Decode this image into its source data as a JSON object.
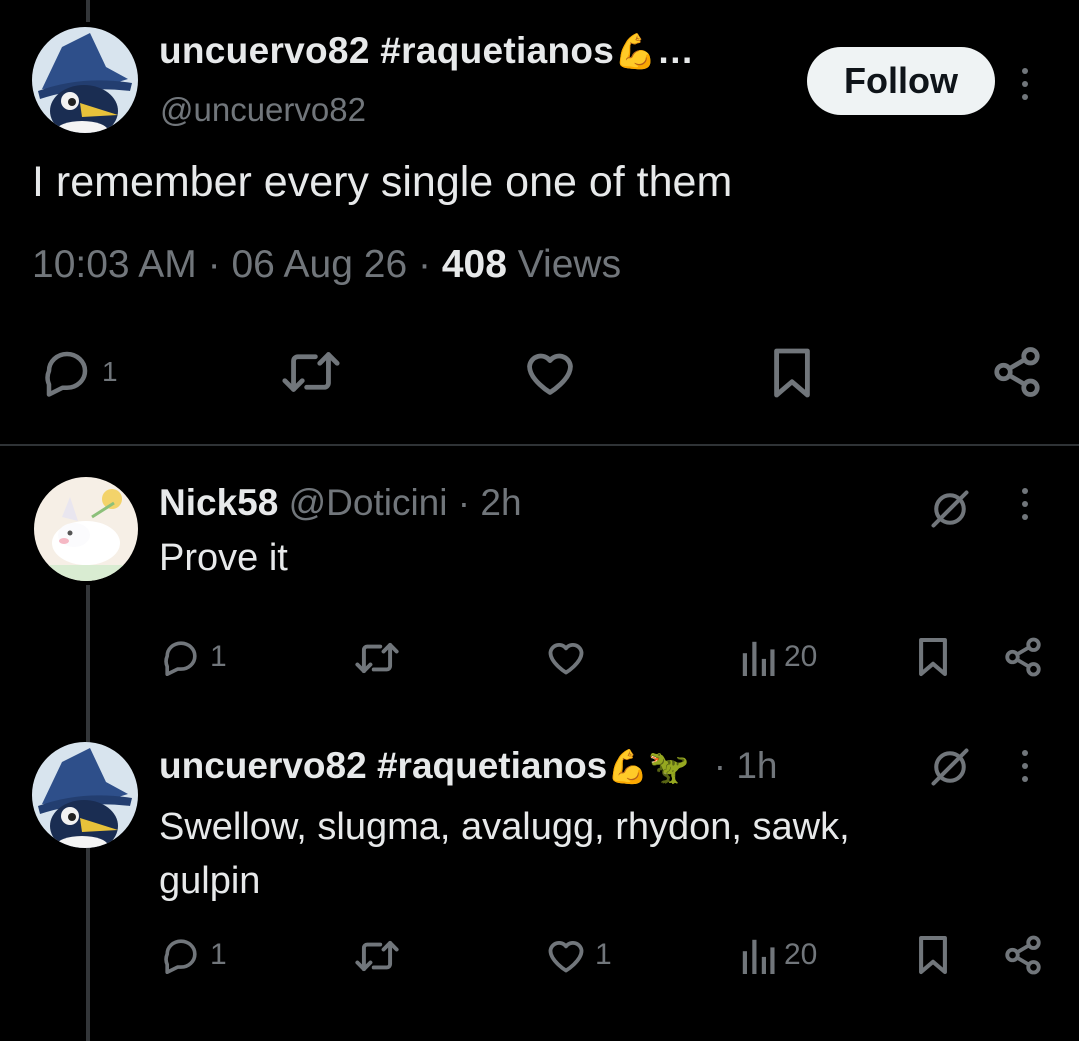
{
  "main_post": {
    "display_name": "uncuervo82 #raquetianos",
    "name_emoji": "💪",
    "truncation": "…",
    "handle": "@uncuervo82",
    "follow_label": "Follow",
    "text": "I remember every single one of them",
    "time": "10:03 AM",
    "date": "06 Aug 26",
    "separator": "·",
    "views_count": "408",
    "views_label": "Views",
    "reply_count": "1",
    "icons": [
      "reply-icon",
      "retweet-icon",
      "like-icon",
      "bookmark-icon",
      "share-icon"
    ]
  },
  "replies": [
    {
      "display_name": "Nick58",
      "handle": "@Doticini",
      "separator": "·",
      "age": "2h",
      "text": "Prove it",
      "reply_count": "1",
      "like_count": "",
      "views_count": "20"
    },
    {
      "display_name": "uncuervo82 #raquetianos",
      "name_emoji": "💪🦖",
      "separator": "·",
      "age": "1h",
      "text_line1": "Swellow, slugma, avalugg, rhydon, sawk,",
      "text_line2": "gulpin",
      "reply_count": "1",
      "like_count": "1",
      "views_count": "20"
    }
  ],
  "colors": {
    "background": "#000000",
    "text": "#e7e9ea",
    "muted": "#71767b",
    "follow_bg": "#eff3f4",
    "divider": "#2f3336"
  }
}
